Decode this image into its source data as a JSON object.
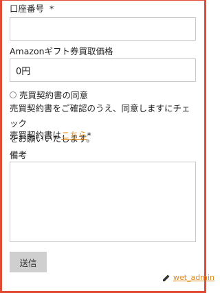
{
  "form": {
    "account_number": {
      "label": "口座番号",
      "required_mark": "*",
      "value": ""
    },
    "amazon_price": {
      "label": "Amazonギフト券買取価格",
      "value": "0円"
    },
    "agreement": {
      "checkbox_label": "売買契約書の同意",
      "description_line1": "売買契約書をご確認のうえ、同意しますにチェック",
      "description_line2": "をお願いいたします。",
      "contract_prefix": "売買契約書は",
      "contract_link": "こちら",
      "contract_required_mark": "*"
    },
    "notes": {
      "label": "備考",
      "value": ""
    },
    "submit_label": "送信"
  },
  "footer": {
    "editor_name": "wet_admin"
  },
  "colors": {
    "frame": "#e24a33",
    "link": "#e08a1e",
    "button_bg": "#cfcfcf"
  },
  "icons": {
    "edit": "pencil-icon",
    "checkbox": "radio-circle"
  }
}
